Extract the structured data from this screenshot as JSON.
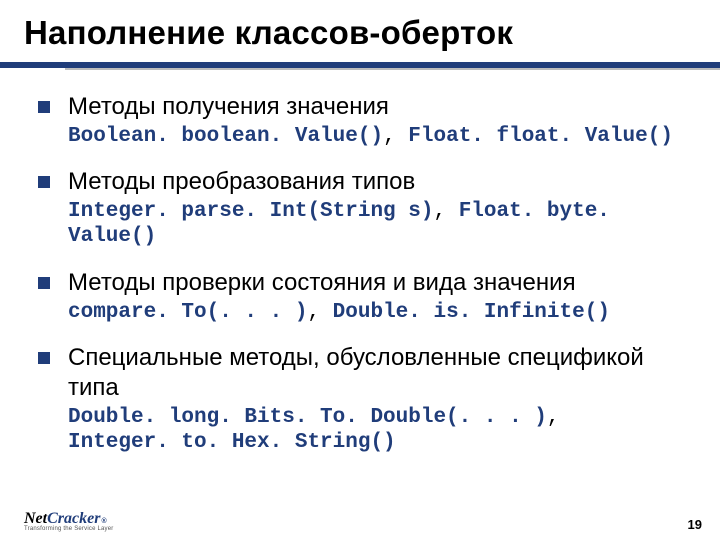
{
  "title": "Наполнение классов-оберток",
  "items": [
    {
      "heading": "Методы получения значения",
      "code_a": "Boolean. boolean. Value()",
      "sep": ", ",
      "code_b": "Float. float. Value()"
    },
    {
      "heading": "Методы преобразования типов",
      "code_a": "Integer. parse. Int(String s)",
      "sep": ", ",
      "code_b": "Float. byte. Value()"
    },
    {
      "heading": "Методы проверки состояния и вида значения",
      "code_a": "compare. To(. . . )",
      "sep": ", ",
      "code_b": "Double. is. Infinite()"
    },
    {
      "heading": "Специальные методы, обусловленные спецификой типа",
      "code_a": "Double. long. Bits. To. Double(. . . )",
      "sep": ",",
      "code_b": "Integer. to. Hex. String()",
      "multiline": true
    }
  ],
  "footer": {
    "logo_left": "Net",
    "logo_right": "Cracker",
    "tm": "®",
    "tagline": "Transforming the Service Layer",
    "page": "19"
  }
}
